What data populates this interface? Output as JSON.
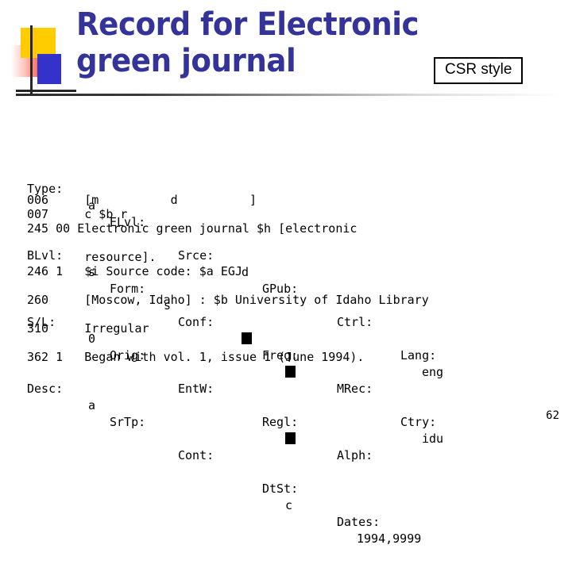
{
  "slide": {
    "page_number": "62",
    "title_line1": "Record for Electronic",
    "title_line2": "green journal",
    "title_color": "#333399",
    "callout_label": "CSR style"
  },
  "logo": {
    "yellow_color": "#ffcc00",
    "blue_color": "#3333cc",
    "red_color": "#f5412a",
    "axis_color": "#262626"
  },
  "fixed_fields": {
    "rows": [
      {
        "f1_label": "Type:",
        "f1_value": "a",
        "f2_label": "ELvl:",
        "f2_value": "",
        "f3_label": "Srce:",
        "f3_value": "d",
        "f4_label": "GPub:",
        "f4_value": "",
        "f5_label": "Ctrl:",
        "f5_value": "",
        "f6_label": "Lang:",
        "f6_value": "eng"
      },
      {
        "f1_label": "BLvl:",
        "f1_value": "s",
        "f2_label": "Form:",
        "f2_value": "s",
        "f3_label": "Conf:",
        "f3_value": "█",
        "f4_label": "Freq:",
        "f4_value": "█",
        "f5_label": "MRec:",
        "f5_value": "",
        "f6_label": "Ctry:",
        "f6_value": "idu"
      },
      {
        "f1_label": "S/L:",
        "f1_value": "0",
        "f2_label": "Orig:",
        "f2_value": "",
        "f3_label": "EntW:",
        "f3_value": "",
        "f4_label": "Regl:",
        "f4_value": "█",
        "f5_label": "Alph:",
        "f5_value": "",
        "f6_label": "",
        "f6_value": ""
      },
      {
        "f1_label": "Desc:",
        "f1_value": "a",
        "f2_label": "SrTp:",
        "f2_value": "",
        "f3_label": "Cont:",
        "f3_value": "",
        "f4_label": "DtSt:",
        "f4_value": "c",
        "f5_label": "Dates:",
        "f5_value": "1994,9999",
        "f6_label": "",
        "f6_value": ""
      }
    ]
  },
  "marc": {
    "lines": [
      "006     [m          d          ]",
      "007     c $b r",
      "245 00 Electronic green journal $h [electronic",
      "",
      "        resource].",
      "246 1   $i Source code: $a EGJ",
      "",
      "260     [Moscow, Idaho] : $b University of Idaho Library",
      "",
      "310     Irregular",
      "",
      "362 1   Began with vol. 1, issue 1 (June 1994)."
    ]
  }
}
